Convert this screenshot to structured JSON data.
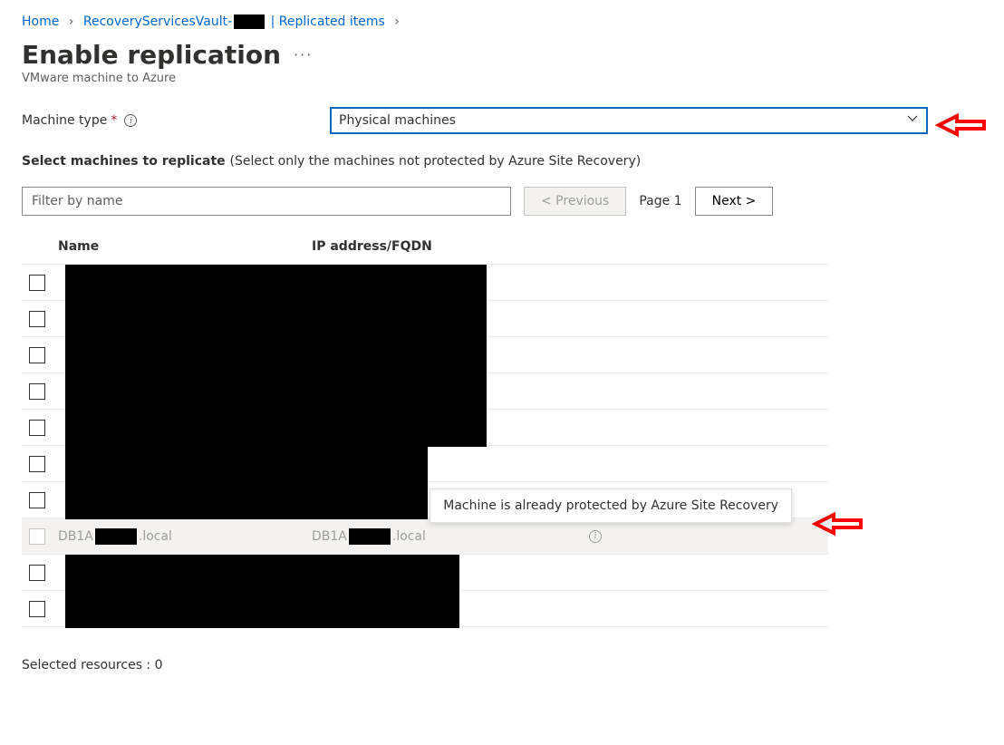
{
  "breadcrumb": {
    "home": "Home",
    "vault_prefix": "RecoveryServicesVault-",
    "vault_suffix": " | Replicated items"
  },
  "header": {
    "title": "Enable replication",
    "ellipsis": "···",
    "subtitle": "VMware machine to Azure"
  },
  "machine_type": {
    "label": "Machine type",
    "value": "Physical machines"
  },
  "select_section": {
    "bold": "Select machines to replicate ",
    "hint": "(Select only the machines not protected by Azure Site Recovery)"
  },
  "toolbar": {
    "filter_placeholder": "Filter by name",
    "prev": "< Previous",
    "page": "Page 1",
    "next": "Next >"
  },
  "table": {
    "col_name": "Name",
    "col_ip": "IP address/FQDN"
  },
  "disabled_row": {
    "name_prefix": "DB1A",
    "name_suffix": ".local",
    "ip_prefix": "DB1A",
    "ip_suffix": ".local"
  },
  "tooltip": "Machine is already protected by Azure Site Recovery",
  "selected": {
    "label": "Selected resources : ",
    "count": "0"
  }
}
